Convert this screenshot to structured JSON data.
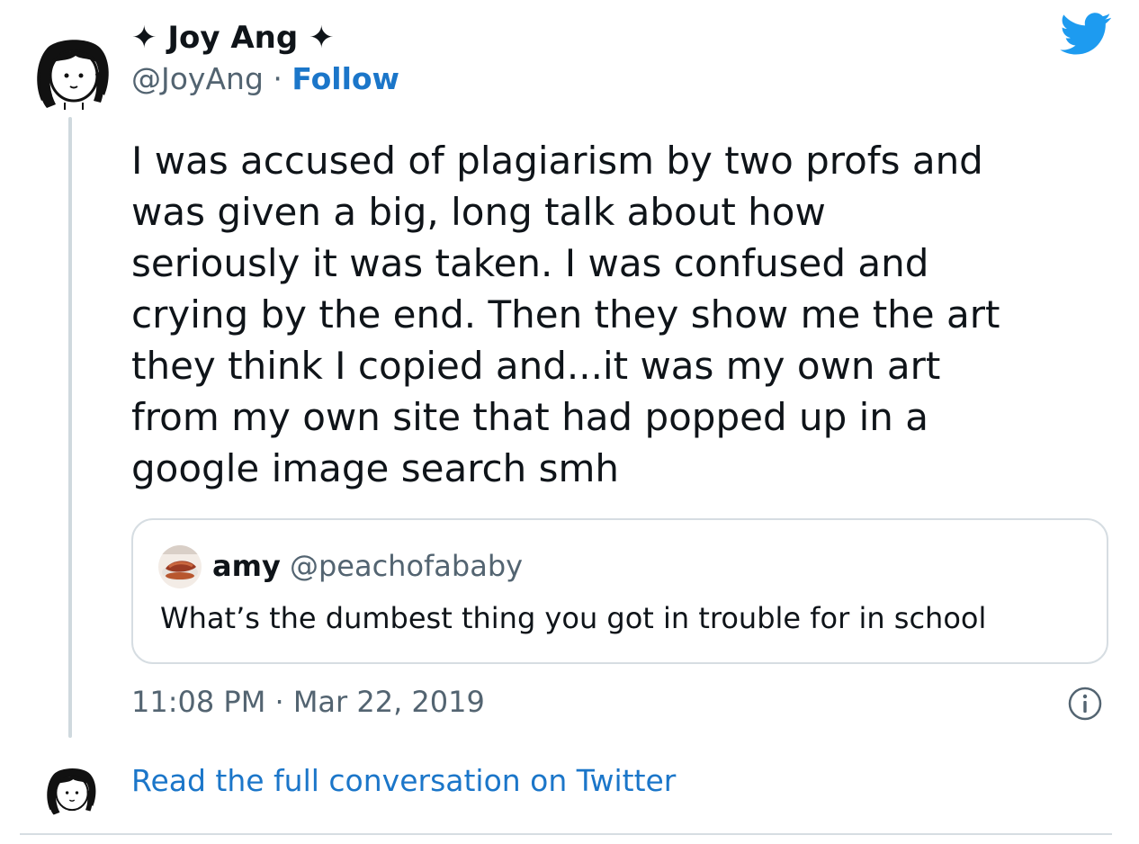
{
  "author": {
    "display_name": "✦ Joy Ang ✦",
    "handle": "@JoyAng",
    "separator": " · ",
    "follow_label": "Follow",
    "avatar_icon": "cartoon-girl-avatar"
  },
  "brand": {
    "icon": "twitter-bird-icon",
    "color": "#1d9bf0"
  },
  "tweet": {
    "text": "I was accused of plagiarism by two profs and\nwas given a big, long talk about how\nseriously it was taken. I was confused and\ncrying by the end. Then they show me the art\nthey think I copied and...it was my own art\nfrom my own site that had popped up in a\ngoogle image search smh",
    "timestamp": "11:08 PM · Mar 22, 2019"
  },
  "quoted_tweet": {
    "name": "amy",
    "handle": "@peachofababy",
    "text": "What’s the dumbest thing you got in trouble for in school",
    "avatar_icon": "food-photo-avatar"
  },
  "footer": {
    "link_text": "Read the full conversation on Twitter",
    "info_icon": "info-icon"
  },
  "colors": {
    "link": "#1b76c9",
    "muted": "#536471",
    "border": "#d6dde2",
    "text": "#0f1419"
  }
}
